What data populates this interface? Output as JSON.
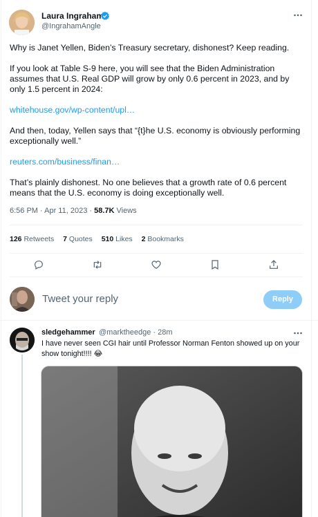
{
  "tweet": {
    "author_name": "Laura Ingraham",
    "author_handle": "@IngrahamAngle",
    "paragraph1": "Why is Janet Yellen, Biden’s Treasury secretary, dishonest? Keep reading.",
    "paragraph2": "If you look at Table S-9 here, you will see that the Biden Administration assumes that U.S. Real GDP will grow by only 0.6 percent in 2023, and by only 1.5 percent in 2024:",
    "link1": "whitehouse.gov/wp-content/upl…",
    "paragraph3": "And then, today, Yellen says that “{t}he U.S. economy is obviously performing exceptionally well.”",
    "link2": "reuters.com/business/finan…",
    "paragraph4": "That’s plainly dishonest.  No one believes that a growth rate of 0.6 percent means that the U.S. economy is doing exceptionally well.",
    "time": "6:56 PM · Apr 11, 2023 · ",
    "views_count": "58.7K",
    "views_label": " Views"
  },
  "stats": {
    "retweets_count": "126",
    "retweets_label": "Retweets",
    "quotes_count": "7",
    "quotes_label": "Quotes",
    "likes_count": "510",
    "likes_label": "Likes",
    "bookmarks_count": "2",
    "bookmarks_label": "Bookmarks"
  },
  "compose": {
    "placeholder": "Tweet your reply",
    "button_label": "Reply"
  },
  "reply": {
    "author_name": "sledgehammer",
    "author_handle": "@marktheedge · 28m",
    "text": "I have never seen CGI hair until Professor Norman Fenton showed up on your show tonight!!!! 😂"
  },
  "colors": {
    "accent": "#1d9bf0",
    "reply_button_disabled": "#8ecdf8",
    "muted_text": "#536471"
  },
  "icons": [
    "verified-icon",
    "more-icon",
    "reply-icon",
    "retweet-icon",
    "like-icon",
    "bookmark-icon",
    "share-icon"
  ]
}
